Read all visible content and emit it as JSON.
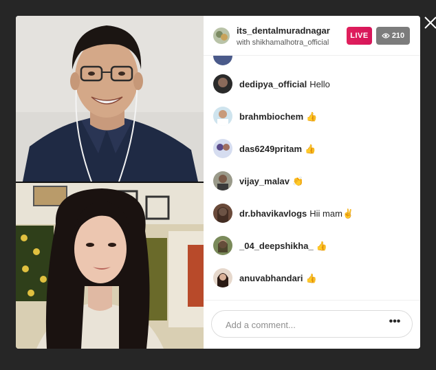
{
  "header": {
    "username": "its_dentalmuradnagar",
    "subtitle": "with shikhamalhotra_official",
    "live_label": "LIVE",
    "viewer_count": "210"
  },
  "comments": [
    {
      "user": "dedipya_official",
      "message": "Hello",
      "emoji": ""
    },
    {
      "user": "brahmbiochem",
      "message": "",
      "emoji": "👍"
    },
    {
      "user": "das6249pritam",
      "message": "",
      "emoji": "👍"
    },
    {
      "user": "vijay_malav",
      "message": "",
      "emoji": "👏"
    },
    {
      "user": "dr.bhavikavlogs",
      "message": "Hii mam",
      "emoji": "✌"
    },
    {
      "user": "_04_deepshikha_",
      "message": "",
      "emoji": "👍"
    },
    {
      "user": "anuvabhandari",
      "message": "",
      "emoji": "👍"
    }
  ],
  "comment_box": {
    "placeholder": "Add a comment...",
    "more_label": "•••"
  },
  "colors": {
    "live": "#d6155a",
    "viewer_badge": "#7c7c7c",
    "backdrop": "#262626"
  }
}
